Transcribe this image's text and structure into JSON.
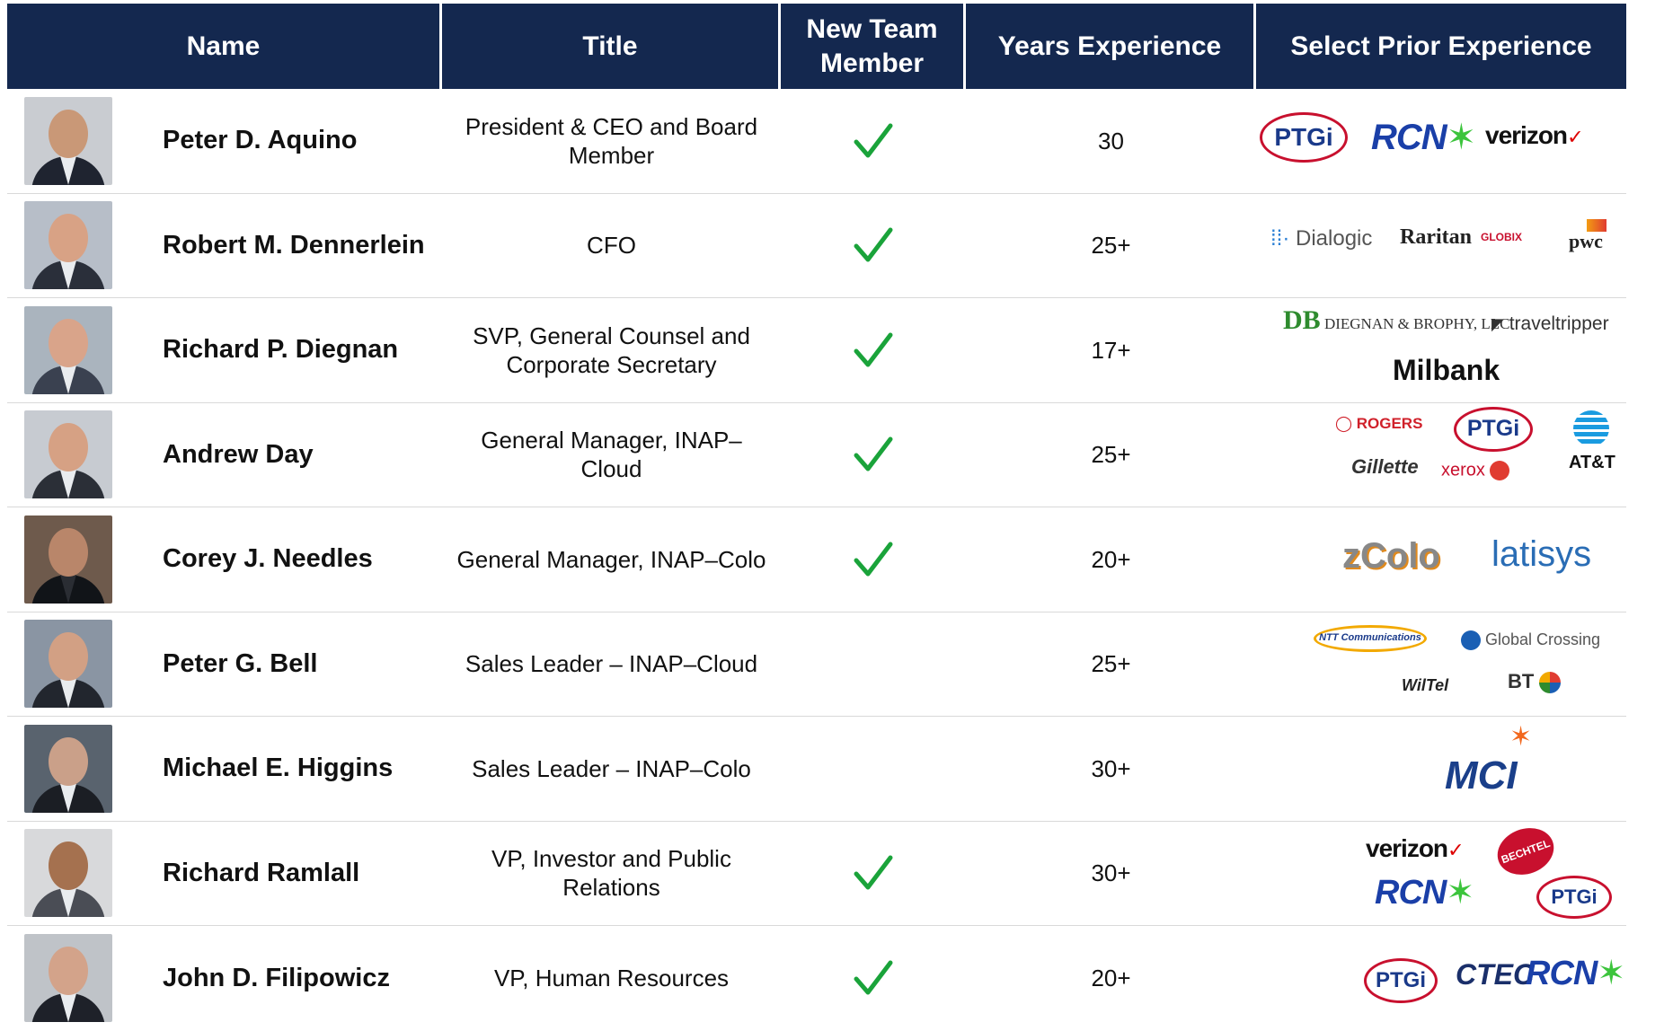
{
  "header": {
    "name": "Name",
    "title": "Title",
    "new_member": "New Team Member",
    "years": "Years Experience",
    "prior": "Select Prior Experience"
  },
  "colors": {
    "header_bg": "#14284f",
    "check": "#1aa33a",
    "row_divider": "#d9d9d9"
  },
  "rows": [
    {
      "name": "Peter D. Aquino",
      "title": "President & CEO and Board Member",
      "new_member": true,
      "years": "30",
      "logos": [
        "PTGi",
        "RCN",
        "verizon"
      ]
    },
    {
      "name": "Robert M. Dennerlein",
      "title": "CFO",
      "new_member": true,
      "years": "25+",
      "logos": [
        "Dialogic",
        "Raritan",
        "GLOBIX",
        "pwc"
      ]
    },
    {
      "name": "Richard P. Diegnan",
      "title": "SVP, General Counsel and Corporate Secretary",
      "new_member": true,
      "years": "17+",
      "logos": [
        "DIEGNAN & BROPHY, LLC",
        "traveltripper",
        "Milbank"
      ]
    },
    {
      "name": "Andrew Day",
      "title": "General Manager, INAP–Cloud",
      "new_member": true,
      "years": "25+",
      "logos": [
        "ROGERS",
        "PTGi",
        "AT&T",
        "Gillette",
        "xerox"
      ]
    },
    {
      "name": "Corey J. Needles",
      "title": "General Manager, INAP–Colo",
      "new_member": true,
      "years": "20+",
      "logos": [
        "zColo",
        "latisys"
      ]
    },
    {
      "name": "Peter G. Bell",
      "title": "Sales Leader – INAP–Cloud",
      "new_member": false,
      "years": "25+",
      "logos": [
        "NTT Communications",
        "Global Crossing",
        "WilTel",
        "BT"
      ]
    },
    {
      "name": "Michael E. Higgins",
      "title": "Sales Leader – INAP–Colo",
      "new_member": false,
      "years": "30+",
      "logos": [
        "MCI"
      ]
    },
    {
      "name": "Richard Ramlall",
      "title": "VP, Investor and Public Relations",
      "new_member": true,
      "years": "30+",
      "logos": [
        "verizon",
        "BECHTEL",
        "RCN",
        "PTGi"
      ]
    },
    {
      "name": "John D. Filipowicz",
      "title": "VP, Human Resources",
      "new_member": true,
      "years": "20+",
      "logos": [
        "PTGi",
        "CTEC",
        "RCN"
      ]
    }
  ]
}
